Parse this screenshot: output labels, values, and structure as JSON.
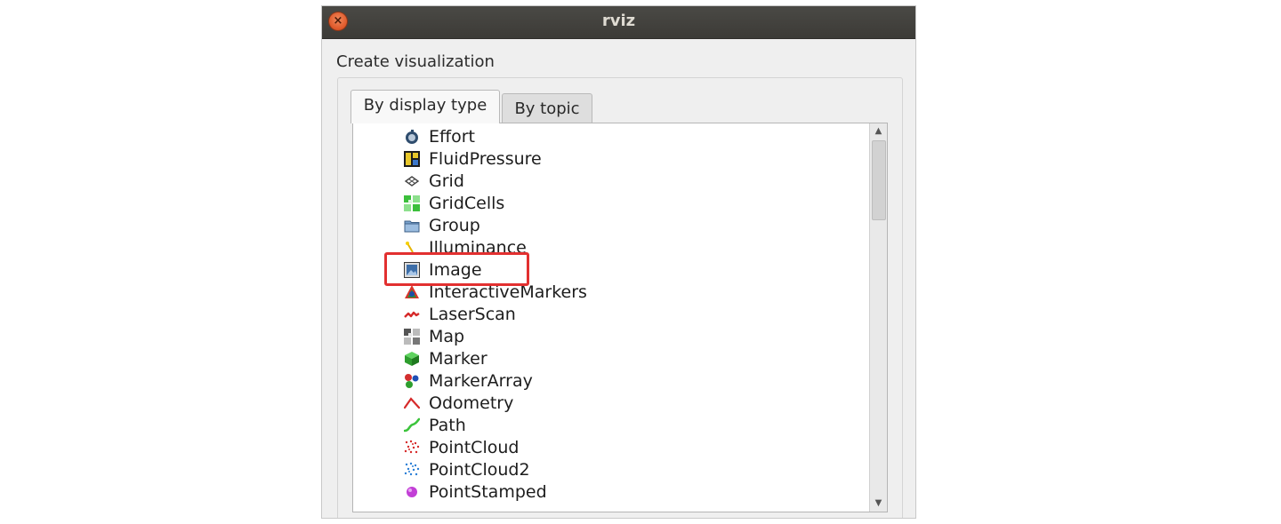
{
  "window": {
    "title": "rviz"
  },
  "dialog": {
    "section_label": "Create visualization",
    "tabs": [
      {
        "label": "By display type",
        "active": true
      },
      {
        "label": "By topic",
        "active": false
      }
    ]
  },
  "list": {
    "items": [
      {
        "label": "Effort",
        "icon": "effort-icon"
      },
      {
        "label": "FluidPressure",
        "icon": "fluid-pressure-icon"
      },
      {
        "label": "Grid",
        "icon": "grid-icon"
      },
      {
        "label": "GridCells",
        "icon": "grid-cells-icon"
      },
      {
        "label": "Group",
        "icon": "folder-icon"
      },
      {
        "label": "Illuminance",
        "icon": "illuminance-icon"
      },
      {
        "label": "Image",
        "icon": "image-icon",
        "highlighted": true
      },
      {
        "label": "InteractiveMarkers",
        "icon": "interactive-markers-icon"
      },
      {
        "label": "LaserScan",
        "icon": "laser-scan-icon"
      },
      {
        "label": "Map",
        "icon": "map-icon"
      },
      {
        "label": "Marker",
        "icon": "marker-cube-icon"
      },
      {
        "label": "MarkerArray",
        "icon": "marker-array-icon"
      },
      {
        "label": "Odometry",
        "icon": "odometry-icon"
      },
      {
        "label": "Path",
        "icon": "path-icon"
      },
      {
        "label": "PointCloud",
        "icon": "point-cloud-icon"
      },
      {
        "label": "PointCloud2",
        "icon": "point-cloud2-icon"
      },
      {
        "label": "PointStamped",
        "icon": "point-stamped-icon"
      }
    ]
  },
  "colors": {
    "titlebar": "#3c3b37",
    "close_button": "#e05a2b",
    "highlight_border": "#e23030"
  }
}
